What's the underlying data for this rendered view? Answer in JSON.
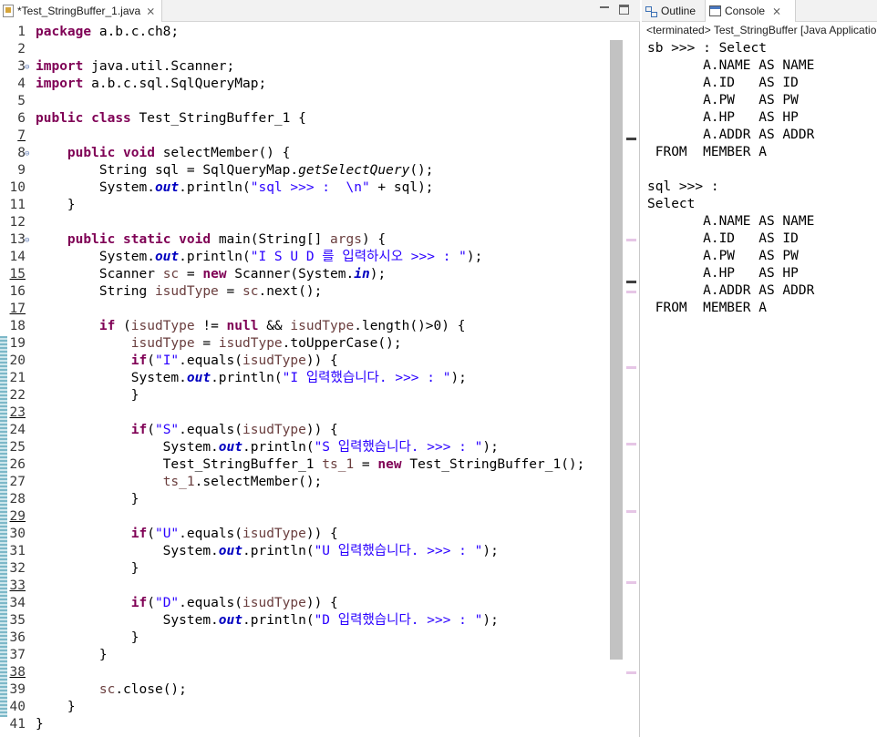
{
  "editor": {
    "tab_label": "*Test_StringBuffer_1.java",
    "tab_close": "⨯",
    "lines": [
      {
        "num": "1",
        "text": "<span class=\"kw\">package</span> a.b.c.ch8;"
      },
      {
        "num": "2",
        "text": ""
      },
      {
        "num": "3",
        "text": "<span class=\"kw\">import</span> java.util.Scanner;",
        "fold": true
      },
      {
        "num": "4",
        "text": "<span class=\"kw\">import</span> a.b.c.sql.SqlQueryMap;"
      },
      {
        "num": "5",
        "text": ""
      },
      {
        "num": "6",
        "text": "<span class=\"kw\">public</span> <span class=\"kw\">class</span> Test_StringBuffer_1 {"
      },
      {
        "num": "7",
        "text": "",
        "underline": true
      },
      {
        "num": "8",
        "text": "    <span class=\"kw\">public</span> <span class=\"kw\">void</span> selectMember() {",
        "fold": true
      },
      {
        "num": "9",
        "text": "        String sql = SqlQueryMap.<span class=\"ital\">getSelectQuery</span>();"
      },
      {
        "num": "10",
        "text": "        System.<span class=\"fld\">out</span>.println(<span class=\"str\">\"sql &gt;&gt;&gt; :  \\n\"</span> + sql);"
      },
      {
        "num": "11",
        "text": "    }"
      },
      {
        "num": "12",
        "text": ""
      },
      {
        "num": "13",
        "text": "    <span class=\"kw\">public</span> <span class=\"kw\">static</span> <span class=\"kw\">void</span> main(String[] <span class=\"var\">args</span>) {",
        "fold": true
      },
      {
        "num": "14",
        "text": "        System.<span class=\"fld\">out</span>.println(<span class=\"str\">\"I S U D 를 입력하시오 &gt;&gt;&gt; : \"</span>);"
      },
      {
        "num": "15",
        "text": "        Scanner <span class=\"var\">sc</span> = <span class=\"kw\">new</span> Scanner(System.<span class=\"fld\">in</span>);",
        "underline": true
      },
      {
        "num": "16",
        "text": "        String <span class=\"var\">isudType</span> = <span class=\"var\">sc</span>.next();"
      },
      {
        "num": "17",
        "text": "",
        "underline": true
      },
      {
        "num": "18",
        "text": "        <span class=\"kw\">if</span> (<span class=\"var\">isudType</span> != <span class=\"kw\">null</span> &amp;&amp; <span class=\"var\">isudType</span>.length()&gt;0) {"
      },
      {
        "num": "19",
        "text": "            <span class=\"var\">isudType</span> = <span class=\"var\">isudType</span>.toUpperCase();"
      },
      {
        "num": "20",
        "text": "            <span class=\"kw\">if</span>(<span class=\"str\">\"I\"</span>.equals(<span class=\"var\">isudType</span>)) {"
      },
      {
        "num": "21",
        "text": "            System.<span class=\"fld\">out</span>.println(<span class=\"str\">\"I 입력했습니다. &gt;&gt;&gt; : \"</span>);"
      },
      {
        "num": "22",
        "text": "            }"
      },
      {
        "num": "23",
        "text": "",
        "underline": true
      },
      {
        "num": "24",
        "text": "            <span class=\"kw\">if</span>(<span class=\"str\">\"S\"</span>.equals(<span class=\"var\">isudType</span>)) {"
      },
      {
        "num": "25",
        "text": "                System.<span class=\"fld\">out</span>.println(<span class=\"str\">\"S 입력했습니다. &gt;&gt;&gt; : \"</span>);"
      },
      {
        "num": "26",
        "text": "                Test_StringBuffer_1 <span class=\"var\">ts_1</span> = <span class=\"kw\">new</span> Test_StringBuffer_1();"
      },
      {
        "num": "27",
        "text": "                <span class=\"var\">ts_1</span>.selectMember();"
      },
      {
        "num": "28",
        "text": "            }"
      },
      {
        "num": "29",
        "text": "",
        "underline": true
      },
      {
        "num": "30",
        "text": "            <span class=\"kw\">if</span>(<span class=\"str\">\"U\"</span>.equals(<span class=\"var\">isudType</span>)) {"
      },
      {
        "num": "31",
        "text": "                System.<span class=\"fld\">out</span>.println(<span class=\"str\">\"U 입력했습니다. &gt;&gt;&gt; : \"</span>);"
      },
      {
        "num": "32",
        "text": "            }"
      },
      {
        "num": "33",
        "text": "",
        "underline": true
      },
      {
        "num": "34",
        "text": "            <span class=\"kw\">if</span>(<span class=\"str\">\"D\"</span>.equals(<span class=\"var\">isudType</span>)) {"
      },
      {
        "num": "35",
        "text": "                System.<span class=\"fld\">out</span>.println(<span class=\"str\">\"D 입력했습니다. &gt;&gt;&gt; : \"</span>);"
      },
      {
        "num": "36",
        "text": "            }"
      },
      {
        "num": "37",
        "text": "        }"
      },
      {
        "num": "38",
        "text": "",
        "underline": true
      },
      {
        "num": "39",
        "text": "        <span class=\"var\">sc</span>.close();"
      },
      {
        "num": "40",
        "text": "    }"
      },
      {
        "num": "41",
        "text": "}"
      }
    ]
  },
  "views": {
    "outline_label": "Outline",
    "console_label": "Console",
    "console_close": "⨯"
  },
  "console": {
    "status": "<terminated> Test_StringBuffer [Java Application",
    "output": [
      "sb >>> : Select",
      "       A.NAME AS NAME",
      "       A.ID   AS ID",
      "       A.PW   AS PW",
      "       A.HP   AS HP",
      "       A.ADDR AS ADDR",
      " FROM  MEMBER A",
      "",
      "sql >>> :",
      "Select",
      "       A.NAME AS NAME",
      "       A.ID   AS ID",
      "       A.PW   AS PW",
      "       A.HP   AS HP",
      "       A.ADDR AS ADDR",
      " FROM  MEMBER A"
    ]
  },
  "colors": {
    "keyword": "#7f0055",
    "string": "#2a00ff",
    "static_field": "#0000c0",
    "local_variable": "#6a3e3e",
    "change_bar": "#7cb8c8"
  }
}
